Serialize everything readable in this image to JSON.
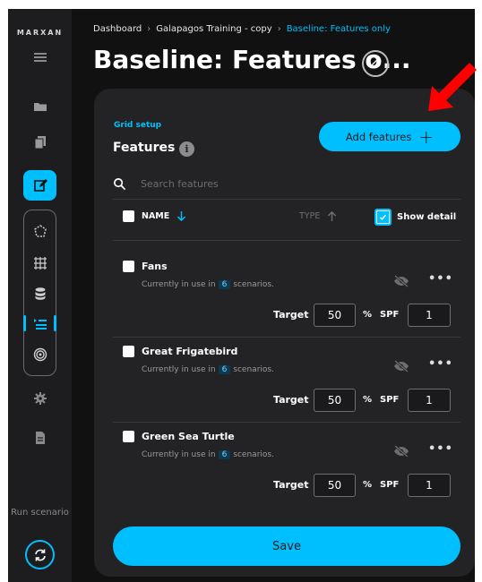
{
  "app": {
    "logo": "MARXAN"
  },
  "breadcrumb": {
    "items": [
      "Dashboard",
      "Galapagos Training - copy"
    ],
    "current": "Baseline: Features only"
  },
  "page": {
    "title": "Baseline: Features o..."
  },
  "sidebar": {
    "run_label": "Run scenario"
  },
  "panel": {
    "section_label": "Grid setup",
    "title": "Features",
    "add_button": "Add features",
    "search_placeholder": "Search features",
    "columns": {
      "name": "NAME",
      "type": "TYPE",
      "show_detail": "Show detail"
    }
  },
  "features": [
    {
      "name": "Fans",
      "usage_prefix": "Currently in use in",
      "usage_count": "6",
      "usage_suffix": "scenarios.",
      "target_label": "Target",
      "target": "50",
      "pct": "%",
      "spf_label": "SPF",
      "spf": "1"
    },
    {
      "name": "Great Frigatebird",
      "usage_prefix": "Currently in use in",
      "usage_count": "6",
      "usage_suffix": "scenarios.",
      "target_label": "Target",
      "target": "50",
      "pct": "%",
      "spf_label": "SPF",
      "spf": "1"
    },
    {
      "name": "Green Sea Turtle",
      "usage_prefix": "Currently in use in",
      "usage_count": "6",
      "usage_suffix": "scenarios.",
      "target_label": "Target",
      "target": "50",
      "pct": "%",
      "spf_label": "SPF",
      "spf": "1"
    }
  ],
  "footer": {
    "save_label": "Save"
  },
  "colors": {
    "accent": "#00bfff",
    "background": "#111111",
    "panel": "#232325",
    "annotation_arrow": "#ff0000"
  }
}
